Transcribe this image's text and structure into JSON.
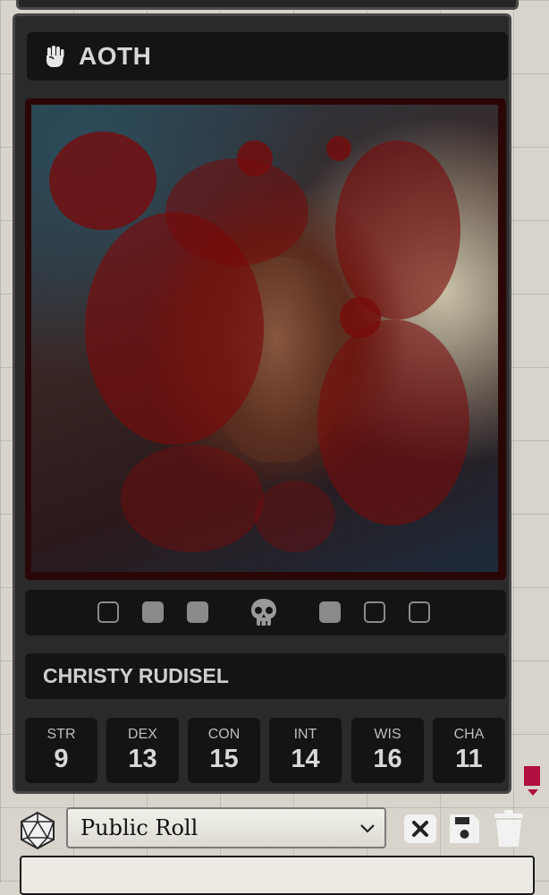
{
  "card": {
    "title": "AOTH",
    "title_icon": "hand-icon",
    "character_name": "CHRISTY RUDISEL"
  },
  "portrait": {
    "description_icon": "portrait-image"
  },
  "death_saves": {
    "left": [
      "empty",
      "filled",
      "filled"
    ],
    "center_icon": "skull-icon",
    "right": [
      "filled",
      "empty",
      "empty"
    ]
  },
  "stats": [
    {
      "label": "STR",
      "value": "9"
    },
    {
      "label": "DEX",
      "value": "13"
    },
    {
      "label": "CON",
      "value": "15"
    },
    {
      "label": "INT",
      "value": "14"
    },
    {
      "label": "WIS",
      "value": "16"
    },
    {
      "label": "CHA",
      "value": "11"
    }
  ],
  "roll": {
    "mode_selected": "Public Roll",
    "icons": [
      "d20-icon",
      "close-icon",
      "save-icon",
      "trash-icon"
    ]
  },
  "colors": {
    "panel_bg": "#2a2a2a",
    "dark_box": "#141414",
    "accent_marker": "#b01040",
    "blood": "#780a0a"
  }
}
